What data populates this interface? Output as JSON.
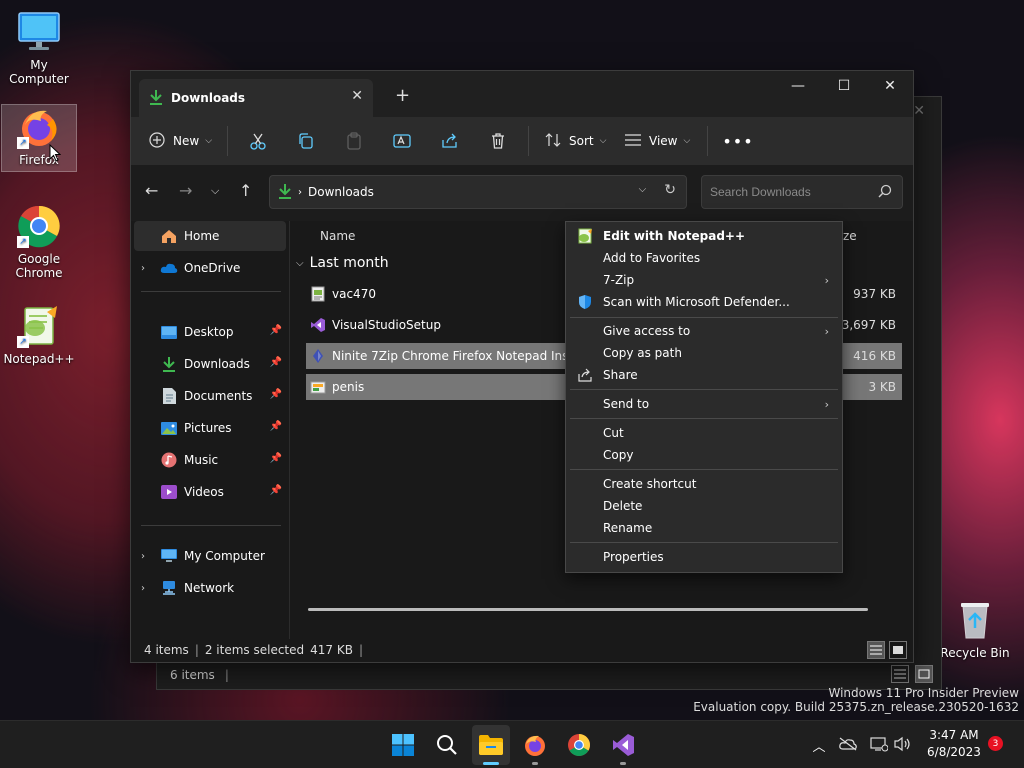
{
  "desktop": {
    "icons": [
      {
        "label": "My Computer"
      },
      {
        "label": "Firefox"
      },
      {
        "label": "Google Chrome"
      },
      {
        "label": "Notepad++"
      },
      {
        "label": "Recycle Bin"
      }
    ]
  },
  "back_window": {
    "status_items": "6 items"
  },
  "window": {
    "tab_title": "Downloads",
    "toolbar": {
      "new_label": "New",
      "sort_label": "Sort",
      "view_label": "View"
    },
    "address": {
      "crumb": "Downloads",
      "search_placeholder": "Search Downloads"
    },
    "nav": {
      "items": [
        {
          "label": "Home"
        },
        {
          "label": "OneDrive"
        },
        {
          "label": "Desktop"
        },
        {
          "label": "Downloads"
        },
        {
          "label": "Documents"
        },
        {
          "label": "Pictures"
        },
        {
          "label": "Music"
        },
        {
          "label": "Videos"
        },
        {
          "label": "My Computer"
        },
        {
          "label": "Network"
        }
      ]
    },
    "files": {
      "col_name": "Name",
      "col_size_partial": "ze",
      "group": "Last month",
      "rows": [
        {
          "name": "vac470",
          "size": "937 KB",
          "selected": false
        },
        {
          "name": "VisualStudioSetup",
          "size": "3,697 KB",
          "selected": false
        },
        {
          "name": "Ninite 7Zip Chrome Firefox Notepad Inst...",
          "size": "416 KB",
          "selected": true
        },
        {
          "name": "penis",
          "size": "3 KB",
          "selected": true
        }
      ]
    },
    "status": {
      "items": "4 items",
      "selected": "2 items selected",
      "size": "417 KB"
    }
  },
  "context_menu": {
    "items": [
      {
        "label": "Edit with Notepad++"
      },
      {
        "label": "Add to Favorites"
      },
      {
        "label": "7-Zip"
      },
      {
        "label": "Scan with Microsoft Defender..."
      },
      {
        "label": "Give access to"
      },
      {
        "label": "Copy as path"
      },
      {
        "label": "Share"
      },
      {
        "label": "Send to"
      },
      {
        "label": "Cut"
      },
      {
        "label": "Copy"
      },
      {
        "label": "Create shortcut"
      },
      {
        "label": "Delete"
      },
      {
        "label": "Rename"
      },
      {
        "label": "Properties"
      }
    ]
  },
  "watermark": {
    "line1": "Windows 11 Pro Insider Preview",
    "line2": "Evaluation copy. Build 25375.zn_release.230520-1632"
  },
  "taskbar": {
    "time": "3:47 AM",
    "date": "6/8/2023",
    "notification_count": "3"
  },
  "colors": {
    "accent": "#60cdff",
    "download_green": "#3fb950",
    "selection": "#777777"
  }
}
